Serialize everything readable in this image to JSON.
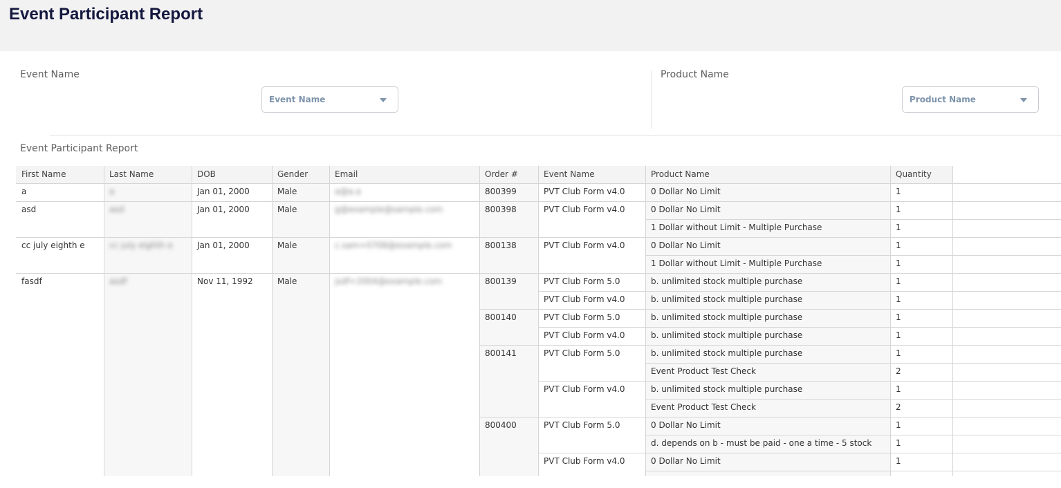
{
  "page": {
    "title": "Event Participant Report"
  },
  "filters": {
    "event": {
      "label": "Event Name",
      "placeholder": "Event Name"
    },
    "product": {
      "label": "Product Name",
      "placeholder": "Product Name"
    }
  },
  "report": {
    "section_title": "Event Participant Report",
    "columns": [
      "First Name",
      "Last Name",
      "DOB",
      "Gender",
      "Email",
      "Order #",
      "Event Name",
      "Product Name",
      "Quantity"
    ],
    "participants": [
      {
        "first": "a",
        "last": "a",
        "dob": "Jan 01, 2000",
        "gender": "Male",
        "email": "a@a.a"
      },
      {
        "first": "asd",
        "last": "asd",
        "dob": "Jan 01, 2000",
        "gender": "Male",
        "email": "g@example@sample.com"
      },
      {
        "first": "cc july eighth e",
        "last": "cc july eighth e",
        "dob": "Jan 01, 2000",
        "gender": "Male",
        "email": "c.sam+0708@example.com"
      },
      {
        "first": "fasdf",
        "last": "asdf",
        "dob": "Nov 11, 1992",
        "gender": "Male",
        "email": "jsdf+2004@example.com"
      }
    ],
    "orders": [
      "800399",
      "800398",
      "800138",
      "800139",
      "800140",
      "800141",
      "800400"
    ],
    "events": [
      "PVT Club Form v4.0",
      "PVT Club Form v4.0",
      "PVT Club Form v4.0",
      "PVT Club Form 5.0",
      "PVT Club Form v4.0",
      "PVT Club Form 5.0",
      "PVT Club Form v4.0",
      "PVT Club Form 5.0",
      "PVT Club Form v4.0",
      "PVT Club Form 5.0",
      "PVT Club Form v4.0"
    ],
    "products": [
      {
        "name": "0 Dollar No Limit",
        "qty": "1"
      },
      {
        "name": "0 Dollar No Limit",
        "qty": "1"
      },
      {
        "name": "1 Dollar without Limit - Multiple Purchase",
        "qty": "1"
      },
      {
        "name": "0 Dollar No Limit",
        "qty": "1"
      },
      {
        "name": "1 Dollar without Limit - Multiple Purchase",
        "qty": "1"
      },
      {
        "name": "b. unlimited stock multiple purchase",
        "qty": "1"
      },
      {
        "name": "b. unlimited stock multiple purchase",
        "qty": "1"
      },
      {
        "name": "b. unlimited stock multiple purchase",
        "qty": "1"
      },
      {
        "name": "b. unlimited stock multiple purchase",
        "qty": "1"
      },
      {
        "name": "b. unlimited stock multiple purchase",
        "qty": "1"
      },
      {
        "name": "Event Product Test Check",
        "qty": "2"
      },
      {
        "name": "b. unlimited stock multiple purchase",
        "qty": "1"
      },
      {
        "name": "Event Product Test Check",
        "qty": "2"
      },
      {
        "name": "0 Dollar No Limit",
        "qty": "1"
      },
      {
        "name": "d. depends on b - must be paid - one a time - 5 stock",
        "qty": "1"
      },
      {
        "name": "0 Dollar No Limit",
        "qty": "1"
      }
    ]
  }
}
